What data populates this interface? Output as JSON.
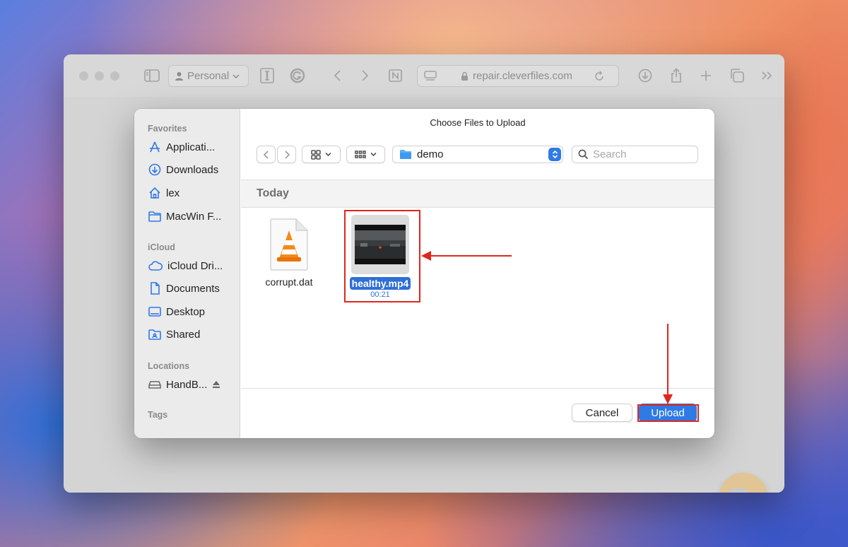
{
  "browser": {
    "profile_label": "Personal",
    "url": "repair.cleverfiles.com"
  },
  "dialog": {
    "title": "Choose Files to Upload",
    "folder": "demo",
    "search_placeholder": "Search",
    "group_header": "Today",
    "cancel_label": "Cancel",
    "upload_label": "Upload"
  },
  "sidebar": {
    "favorites_title": "Favorites",
    "favorites": [
      {
        "label": "Applicati...",
        "icon": "applications-icon"
      },
      {
        "label": "Downloads",
        "icon": "downloads-icon"
      },
      {
        "label": "lex",
        "icon": "home-icon"
      },
      {
        "label": "MacWin F...",
        "icon": "folder-icon"
      }
    ],
    "icloud_title": "iCloud",
    "icloud": [
      {
        "label": "iCloud Dri...",
        "icon": "cloud-icon"
      },
      {
        "label": "Documents",
        "icon": "document-icon"
      },
      {
        "label": "Desktop",
        "icon": "desktop-icon"
      },
      {
        "label": "Shared",
        "icon": "shared-folder-icon"
      }
    ],
    "locations_title": "Locations",
    "locations": [
      {
        "label": "HandB...",
        "icon": "drive-icon"
      }
    ],
    "tags_title": "Tags"
  },
  "files": [
    {
      "name": "corrupt.dat",
      "icon": "vlc-file-icon"
    },
    {
      "name": "healthy.mp4",
      "duration": "00:21",
      "selected": true
    }
  ],
  "colors": {
    "accent": "#2f7ae5",
    "annotation_red": "#e0261c"
  }
}
